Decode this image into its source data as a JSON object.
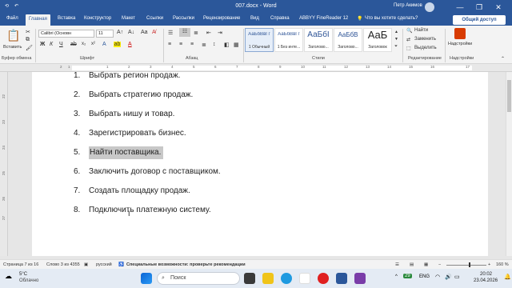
{
  "window": {
    "title": "007.docx  -  Word",
    "user_name": "Петр Акимов",
    "minimize": "—",
    "restore": "❐",
    "close": "✕"
  },
  "tabs": [
    "Файл",
    "Главная",
    "Вставка",
    "Конструктор",
    "Макет",
    "Ссылки",
    "Рассылки",
    "Рецензирование",
    "Вид",
    "Справка",
    "ABBYY FineReader 12"
  ],
  "active_tab": "Главная",
  "tell_me": "Что вы хотите сделать?",
  "share_label": "Общий доступ",
  "ribbon": {
    "paste_label": "Вставить",
    "font_name": "Calibri (Основн",
    "font_size": "11",
    "font_buttons": [
      "Ж",
      "К",
      "Ч"
    ],
    "group_labels": [
      "Буфер обмена",
      "Шрифт",
      "Абзац",
      "Стили",
      "Редактирование",
      "Надстройки"
    ],
    "styles": [
      {
        "preview": "АаБбВвГг",
        "name": "1 Обычный"
      },
      {
        "preview": "АаБбВвГг",
        "name": "1 Без инте..."
      },
      {
        "preview": "АаБбI",
        "name": "Заголово..."
      },
      {
        "preview": "АаБбВ",
        "name": "Заголово..."
      },
      {
        "preview": "АаБ",
        "name": "Заголовок"
      }
    ],
    "editing": [
      "Найти",
      "Заменить",
      "Выделить"
    ],
    "addins_label": "Надстройки"
  },
  "ruler_numbers": [
    "2",
    "1",
    "1",
    "2",
    "3",
    "4",
    "5",
    "6",
    "7",
    "8",
    "9",
    "10",
    "11",
    "12",
    "13",
    "14",
    "15",
    "16",
    "17"
  ],
  "vruler_numbers": [
    "22",
    "23",
    "24",
    "25",
    "26",
    "27"
  ],
  "document": {
    "items": [
      {
        "num": "1.",
        "text": "Выбрать регион продаж."
      },
      {
        "num": "2.",
        "text": "Выбрать стратегию продаж."
      },
      {
        "num": "3.",
        "text": "Выбрать нишу и товар."
      },
      {
        "num": "4.",
        "text": "Зарегистрировать бизнес."
      },
      {
        "num": "5.",
        "text": "Найти поставщика."
      },
      {
        "num": "6.",
        "text": "Заключить договор с поставщиком."
      },
      {
        "num": "7.",
        "text": "Создать площадку продаж."
      },
      {
        "num": "8.",
        "text": "Подключить платежную систему."
      }
    ],
    "highlighted_index": 4
  },
  "status": {
    "page": "Страница 7 из 16",
    "words": "Слово 3 из 4355",
    "language": "русский",
    "accessibility": "Специальные возможности: проверьте рекомендации",
    "zoom": "160 %"
  },
  "taskbar": {
    "weather_temp": "5°C",
    "weather_desc": "Облачно",
    "search_placeholder": "Поиск",
    "lang": "ENG",
    "time": "20:02",
    "date": "23.04.2026",
    "badge": "29"
  },
  "colors": {
    "word_blue": "#2b579a",
    "highlight": "#c8c8c8"
  }
}
